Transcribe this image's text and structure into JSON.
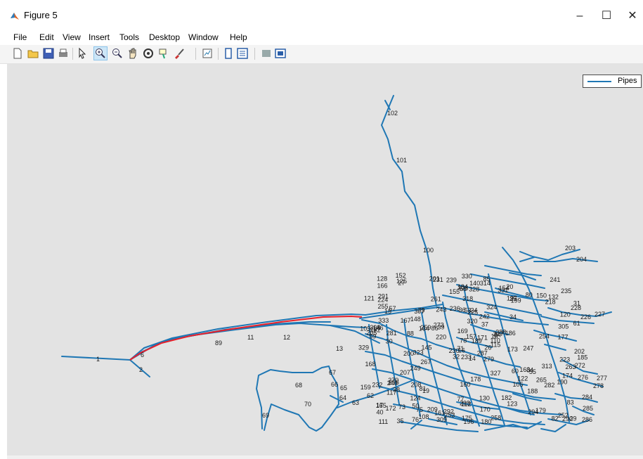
{
  "window": {
    "title": "Figure 5",
    "minimize_glyph": "–",
    "maximize_glyph": "☐",
    "close_glyph": "✕"
  },
  "menu": [
    "File",
    "Edit",
    "View",
    "Insert",
    "Tools",
    "Desktop",
    "Window",
    "Help"
  ],
  "toolbar": {
    "icons": [
      "new-figure-icon",
      "open-file-icon",
      "save-icon",
      "print-icon",
      "pointer-icon",
      "zoom-in-icon",
      "zoom-out-icon",
      "pan-icon",
      "rotate-3d-icon",
      "data-cursor-icon",
      "brush-icon",
      "link-plot-icon",
      "colorbar-icon",
      "legend-icon",
      "hide-plot-tools-icon",
      "show-plot-tools-icon"
    ],
    "active": "zoom-in-icon"
  },
  "legend": {
    "label": "Pipes",
    "color": "#1f77b4"
  },
  "colors": {
    "pipe": "#1f77b4",
    "highlight": "#e8202a",
    "axes_bg": "#e3e3e3"
  },
  "node_labels": [
    "1",
    "2",
    "6",
    "89",
    "11",
    "12",
    "13",
    "14",
    "15",
    "16",
    "17",
    "18",
    "19",
    "20",
    "24",
    "25",
    "26",
    "27",
    "29",
    "30",
    "31",
    "32",
    "34",
    "35",
    "36",
    "37",
    "38",
    "39",
    "40",
    "50",
    "53",
    "54",
    "55",
    "57",
    "58",
    "59",
    "60",
    "61",
    "62",
    "63",
    "64",
    "65",
    "66",
    "67",
    "68",
    "69",
    "70",
    "71",
    "73",
    "75",
    "76",
    "77",
    "78",
    "79",
    "80",
    "81",
    "82",
    "83",
    "84",
    "85",
    "86",
    "88",
    "100",
    "101",
    "102",
    "105",
    "108",
    "109",
    "110",
    "111",
    "112",
    "115",
    "117",
    "120",
    "121",
    "122",
    "123",
    "124",
    "125",
    "128",
    "130",
    "132",
    "140",
    "145",
    "146",
    "148",
    "150",
    "152",
    "154",
    "155",
    "157",
    "159",
    "160",
    "161",
    "163",
    "164",
    "165",
    "166",
    "167",
    "168",
    "169",
    "170",
    "171",
    "172",
    "173",
    "174",
    "175",
    "177",
    "178",
    "179",
    "180",
    "182",
    "184",
    "185",
    "186",
    "188",
    "189",
    "190",
    "192",
    "196",
    "197",
    "199",
    "200",
    "201",
    "202",
    "203",
    "204",
    "205",
    "207",
    "208",
    "209",
    "217",
    "218",
    "220",
    "223",
    "224",
    "225",
    "226",
    "227",
    "228",
    "230",
    "231",
    "232",
    "233",
    "235",
    "236",
    "239",
    "240",
    "241",
    "242",
    "243",
    "247",
    "249",
    "252",
    "253",
    "254",
    "255",
    "256",
    "258",
    "259",
    "261",
    "263",
    "265",
    "267",
    "270",
    "272",
    "273",
    "276",
    "277",
    "278",
    "279",
    "281",
    "282",
    "284",
    "285",
    "286",
    "287",
    "288",
    "290",
    "291",
    "292",
    "294",
    "299",
    "303",
    "305",
    "307",
    "308",
    "309",
    "313",
    "314",
    "318",
    "320",
    "323",
    "324",
    "327",
    "328",
    "329",
    "330",
    "331",
    "333"
  ]
}
